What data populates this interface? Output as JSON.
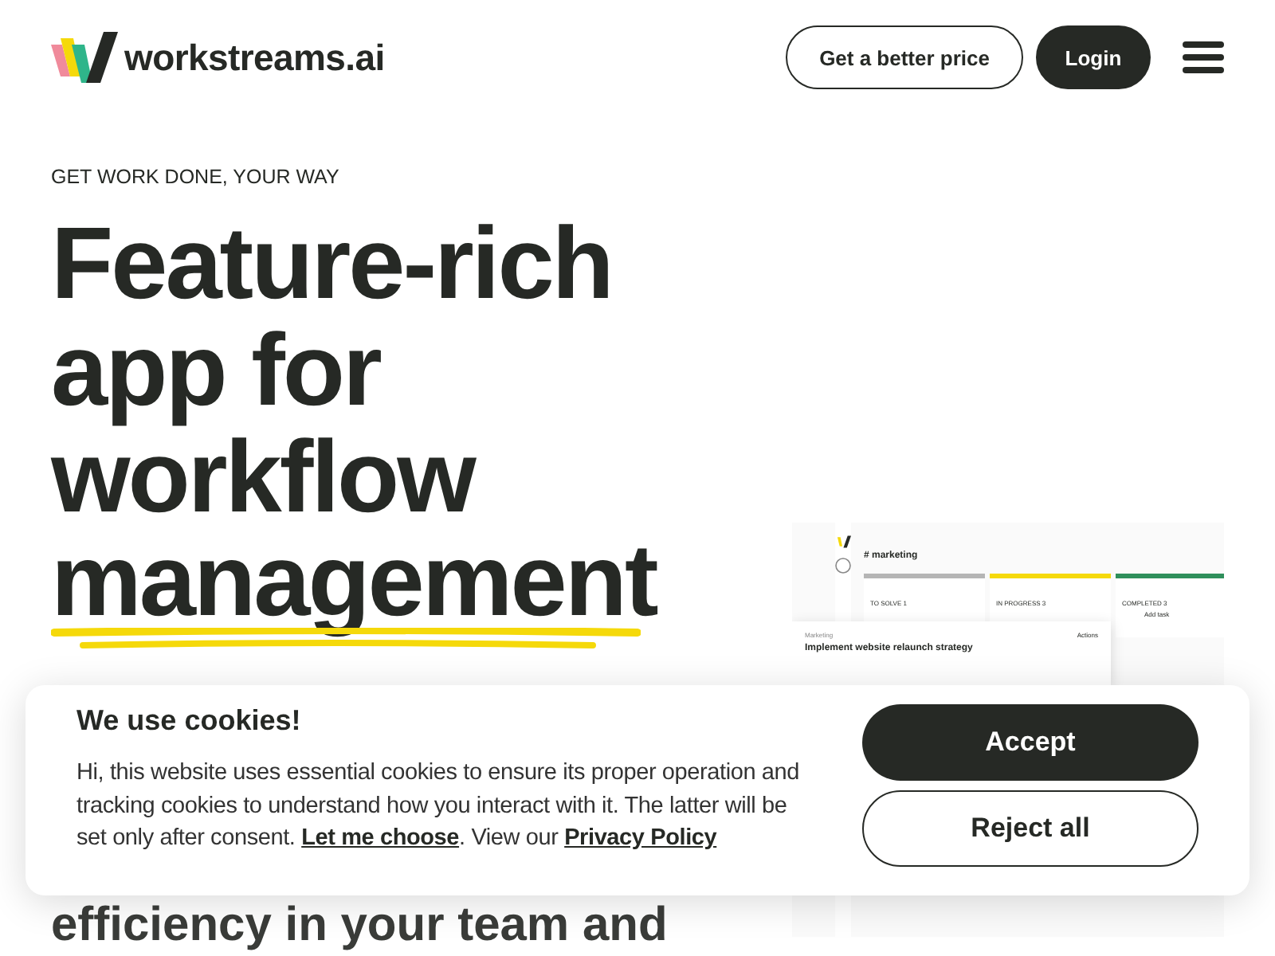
{
  "header": {
    "brand": "workstreams.ai",
    "buttons": [
      {
        "label": "Get a better price",
        "kind": "outline"
      },
      {
        "label": "Login",
        "kind": "solid"
      }
    ]
  },
  "hero": {
    "eyebrow": "GET WORK DONE, YOUR WAY",
    "title_lines": [
      "Feature-rich",
      "app for",
      "workflow"
    ],
    "highlight": "management",
    "subtitle": "efficiency in your team and"
  },
  "app_preview": {
    "channel": "# marketing",
    "columns": [
      {
        "title": "TO SOLVE 1",
        "color": "#b5b5b5"
      },
      {
        "title": "IN PROGRESS 3",
        "color": "#f5d90a"
      },
      {
        "title": "COMPLETED 3",
        "color": "#2f8f5b"
      }
    ],
    "add_task": "Add task",
    "task_breadcrumb": "Marketing",
    "task_title": "Implement website relaunch strategy",
    "task_panel": "Actions"
  },
  "cookie_banner": {
    "title": "We use cookies!",
    "text_before": "Hi, this website uses essential cookies to ensure its proper operation and tracking cookies to understand how you interact with it. The latter will be set only after consent. ",
    "link_choose": "Let me choose",
    "text_middle": ". View our ",
    "link_policy": "Privacy Policy",
    "buttons": [
      {
        "label": "Accept",
        "kind": "solid"
      },
      {
        "label": "Reject all",
        "kind": "outline"
      }
    ]
  }
}
